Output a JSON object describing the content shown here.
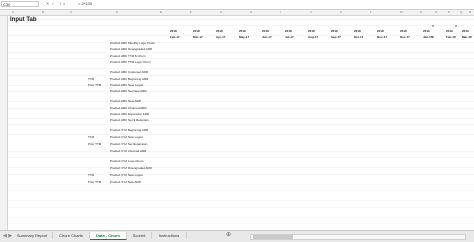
{
  "formula_bar": {
    "name_box": "C30",
    "fx": "fx",
    "formula": "=-2*100"
  },
  "column_headers": [
    "A",
    "B",
    "C",
    "D",
    "E",
    "F",
    "G",
    "H",
    "I",
    "J",
    "K",
    "L",
    "M",
    "N",
    "O",
    "P",
    "Q",
    "R"
  ],
  "sheet_title": "Input Tab",
  "header_years": [
    "2018",
    "2018",
    "2018",
    "2018",
    "2018",
    "2018",
    "2018",
    "2018",
    "2018",
    "2018",
    "2018",
    "2019",
    "2019",
    "2019"
  ],
  "header_months": [
    "Feb-17",
    "Mar-17",
    "Apr-17",
    "May-17",
    "Jun-17",
    "Jul-17",
    "Aug-17",
    "Sep-17",
    "Oct-17",
    "Nov-17",
    "Dec-17",
    "Jan-18",
    "Feb-18",
    "Mar-18"
  ],
  "labels": [
    "Product ABC Monthly Logo Churn",
    "Product ABC Downgraded ARR",
    "Product ABC TTM $ Churn",
    "Product ABC TTM Logo Churn",
    "Product ABC Customer ARR",
    "Product ABC Beginning ARR",
    "Product ABC New Logos",
    "Product ABC Net New ARR",
    "Product ABC New ARR",
    "Product ABC Churned ARR",
    "Product ABC Expansion ARR",
    "Product ABC Net $ Retention",
    "Product XYZ Beginning ARR",
    "Product XYZ New Logos",
    "Product XYZ Net Expansion",
    "Product XYZ Churned ARR",
    "Product XYZ Logo Churn",
    "Product XYZ Downgraded ARR",
    "Product XYZ New Logos",
    "Product XYZ New ARR"
  ],
  "ttm_labels": [
    "TTM",
    "Prior TTM"
  ],
  "tabs": [
    {
      "label": "Summary Report"
    },
    {
      "label": "Churn Charts"
    },
    {
      "label": "Data - Churn"
    },
    {
      "label": "Scored"
    },
    {
      "label": "Instructions"
    }
  ],
  "active_tab": "Data - Churn",
  "icons": {
    "nav": "sheet-nav-arrows-icon",
    "add": "add-sheet-icon"
  }
}
